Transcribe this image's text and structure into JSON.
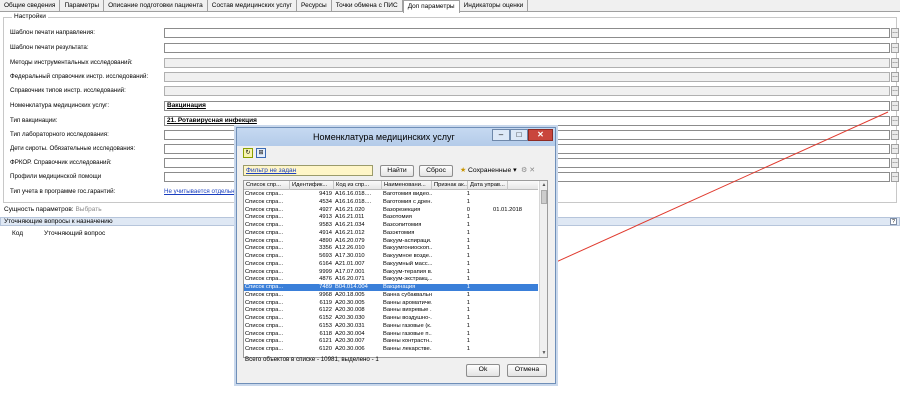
{
  "tabs": [
    {
      "label": "Общие сведения"
    },
    {
      "label": "Параметры"
    },
    {
      "label": "Описание подготовки пациента"
    },
    {
      "label": "Состав медицинских услуг"
    },
    {
      "label": "Ресурсы"
    },
    {
      "label": "Точки обмена с ПИС"
    },
    {
      "label": "Доп параметры",
      "active": true
    },
    {
      "label": "Индикаторы оценки"
    }
  ],
  "settings": {
    "title": "Настройки",
    "fields": [
      {
        "label": "Шаблон печати направления:",
        "value": "",
        "disabled": false
      },
      {
        "label": "Шаблон печати результата:",
        "value": "",
        "disabled": false
      },
      {
        "label": "Методы инструментальных исследований:",
        "value": "",
        "disabled": true
      },
      {
        "label": "Федеральный справочник инстр. исследований:",
        "value": "",
        "disabled": true
      },
      {
        "label": "Справочник типов инстр. исследований:",
        "value": "",
        "disabled": true
      },
      {
        "label": "Номенклатура медицинских услуг:",
        "value": "Вакцинация",
        "disabled": false
      },
      {
        "label": "Тип вакцинации:",
        "value": "21. Ротавирусная инфекция",
        "disabled": false
      },
      {
        "label": "Тип лабораторного исследования:",
        "value": "",
        "disabled": false
      },
      {
        "label": "Дети сироты. Обязательные исследования:",
        "value": "",
        "disabled": false
      },
      {
        "label": "ФРКОР. Справочник исследований:",
        "value": "",
        "disabled": false
      },
      {
        "label": "Профили медицинской помощи",
        "value": "",
        "disabled": false
      }
    ],
    "gov_label": "Тип учета в программе гос.гарантий:",
    "gov_value": "Не учитывается отдельно"
  },
  "essence": {
    "label": "Сущность параметров:",
    "value": "Выбрать"
  },
  "clarify_panel": {
    "title": "Уточняющие вопросы к назначению",
    "help": "?"
  },
  "grid_head": {
    "col1": "Код",
    "col2": "Уточняющий вопрос"
  },
  "dialog": {
    "title": "Номенклатура медицинских услуг",
    "filter": "Фильтр не задан",
    "find_btn": "Найти",
    "reset_btn": "Сброс",
    "saved_label": "Сохраненные",
    "columns": [
      "Список спр...",
      "Идентифик...",
      "Код из спр...",
      "Наименовани...",
      "Признак ак...",
      "Дата управ..."
    ],
    "rows": [
      {
        "list": "Список спра...",
        "id": "9419",
        "code": "A16.16.018....",
        "name": "Ваготомия видео...",
        "flag": "1",
        "date": ""
      },
      {
        "list": "Список спра...",
        "id": "4534",
        "code": "A16.16.018....",
        "name": "Ваготомия с дрен...",
        "flag": "1",
        "date": ""
      },
      {
        "list": "Список спра...",
        "id": "4927",
        "code": "A16.21.020",
        "name": "Вазорезекция",
        "flag": "0",
        "date": "01.01.2018"
      },
      {
        "list": "Список спра...",
        "id": "4913",
        "code": "A16.21.011",
        "name": "Вазотомия",
        "flag": "1",
        "date": ""
      },
      {
        "list": "Список спра...",
        "id": "9583",
        "code": "A16.21.034",
        "name": "Вазоэпитомия",
        "flag": "1",
        "date": ""
      },
      {
        "list": "Список спра...",
        "id": "4914",
        "code": "A16.21.012",
        "name": "Вазэктомия",
        "flag": "1",
        "date": ""
      },
      {
        "list": "Список спра...",
        "id": "4890",
        "code": "A16.20.079",
        "name": "Вакуум-аспираци...",
        "flag": "1",
        "date": ""
      },
      {
        "list": "Список спра...",
        "id": "3356",
        "code": "A12.26.010",
        "name": "Вакуумгониоскоп...",
        "flag": "1",
        "date": ""
      },
      {
        "list": "Список спра...",
        "id": "5693",
        "code": "A17.30.010",
        "name": "Вакуумное возде...",
        "flag": "1",
        "date": ""
      },
      {
        "list": "Список спра...",
        "id": "6164",
        "code": "A21.01.007",
        "name": "Вакуумный масс...",
        "flag": "1",
        "date": ""
      },
      {
        "list": "Список спра...",
        "id": "9999",
        "code": "A17.07.001",
        "name": "Вакуум-терапия в...",
        "flag": "1",
        "date": ""
      },
      {
        "list": "Список спра...",
        "id": "4876",
        "code": "A16.20.071",
        "name": "Вакуум-экстракц...",
        "flag": "1",
        "date": ""
      },
      {
        "list": "Список спра...",
        "id": "7489",
        "code": "B04.014.004",
        "name": "Вакцинация",
        "flag": "1",
        "date": "",
        "selected": true
      },
      {
        "list": "Список спра...",
        "id": "9968",
        "code": "A20.18.005",
        "name": "Ванна субаквальн...",
        "flag": "1",
        "date": ""
      },
      {
        "list": "Список спра...",
        "id": "6119",
        "code": "A20.30.005",
        "name": "Ванны ароматиче...",
        "flag": "1",
        "date": ""
      },
      {
        "list": "Список спра...",
        "id": "6122",
        "code": "A20.30.008",
        "name": "Ванны вихревые ...",
        "flag": "1",
        "date": ""
      },
      {
        "list": "Список спра...",
        "id": "6152",
        "code": "A20.30.030",
        "name": "Ванны воздушно-...",
        "flag": "1",
        "date": ""
      },
      {
        "list": "Список спра...",
        "id": "6153",
        "code": "A20.30.031",
        "name": "Ванны газовые (к...",
        "flag": "1",
        "date": ""
      },
      {
        "list": "Список спра...",
        "id": "6118",
        "code": "A20.30.004",
        "name": "Ванны газовые п...",
        "flag": "1",
        "date": ""
      },
      {
        "list": "Список спра...",
        "id": "6121",
        "code": "A20.30.007",
        "name": "Ванны контрастн...",
        "flag": "1",
        "date": ""
      },
      {
        "list": "Список спра...",
        "id": "6120",
        "code": "A20.30.006",
        "name": "Ванны лекарстве...",
        "flag": "1",
        "date": ""
      }
    ],
    "status": "Всего объектов в списке - 10981, выделено - 1",
    "ok_btn": "Ok",
    "cancel_btn": "Отмена"
  },
  "colors": {
    "selection": "#3a7fd9",
    "annotation_arrow": "#e03a2e",
    "title_bar": "#c6d9f1",
    "close_button": "#c9463d"
  }
}
